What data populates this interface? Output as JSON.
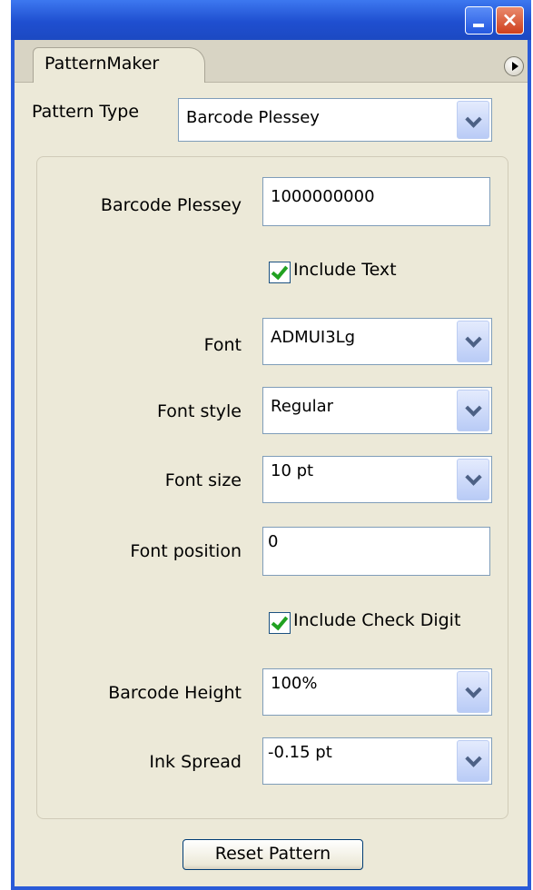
{
  "panel": {
    "tab_label": "PatternMaker"
  },
  "pattern_type": {
    "label": "Pattern Type",
    "value": "Barcode Plessey"
  },
  "fields": {
    "barcode_plessey": {
      "label": "Barcode Plessey",
      "value": "1000000000"
    },
    "include_text": {
      "label": "Include Text",
      "checked": true
    },
    "font": {
      "label": "Font",
      "value": "ADMUI3Lg"
    },
    "font_style": {
      "label": "Font style",
      "value": "Regular"
    },
    "font_size": {
      "label": "Font size",
      "value": "10 pt"
    },
    "font_position": {
      "label": "Font position",
      "value": "0"
    },
    "include_check_digit": {
      "label": "Include Check Digit",
      "checked": true
    },
    "barcode_height": {
      "label": "Barcode Height",
      "value": "100%"
    },
    "ink_spread": {
      "label": "Ink Spread",
      "value": "-0.15 pt"
    }
  },
  "reset_button": {
    "label": "Reset Pattern"
  },
  "icons": {
    "minimize": "minimize-icon",
    "close": "close-icon",
    "panel_menu": "panel-menu-icon"
  },
  "colors": {
    "titlebar": "#2a5bd8",
    "panel_bg": "#ece9d8",
    "field_border": "#7f9db9",
    "check": "#21a121"
  }
}
